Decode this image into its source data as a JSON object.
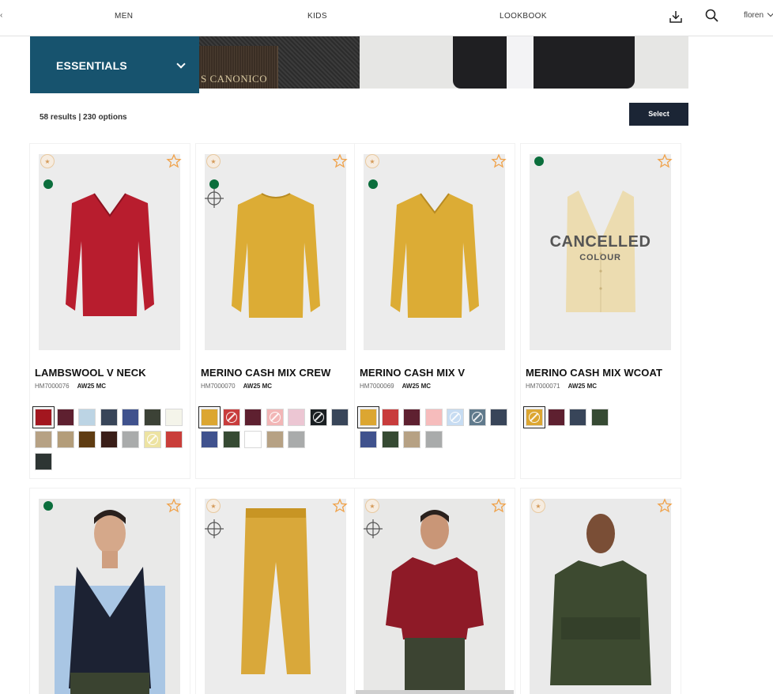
{
  "nav": {
    "edge": "‹",
    "links": [
      "MEN",
      "KIDS",
      "LOOKBOOK"
    ],
    "user": "floren"
  },
  "banner": {
    "category": "ESSENTIALS",
    "fabric_text": "S CANONICO"
  },
  "results": {
    "summary": "58 results | 230 options",
    "select_label": "Select"
  },
  "colors": {
    "accent": "#17536e",
    "button": "#1b2535",
    "available": "#0b6e3c",
    "favorite": "#f0a24a"
  },
  "products": [
    {
      "name": "LAMBSWOOL V NECK",
      "code": "HM7000076",
      "season": "AW25 MC",
      "garment_color": "#b81d2e",
      "swatches": [
        "#a3161f",
        "#5e2030",
        "#bcd4e4",
        "#384559",
        "#40528d",
        "#3c4236",
        "#f4f4ea",
        "#b6a184",
        "#b39d7a",
        "#5f3c12",
        "#3a1e18",
        "#a9abab",
        "#ede3a2",
        "#c93e3a",
        "#2d3533"
      ],
      "banned": [
        12
      ]
    },
    {
      "name": "MERINO CASH MIX CREW",
      "code": "HM7000070",
      "season": "AW25 MC",
      "garment_color": "#dcac35",
      "swatches": [
        "#dca631",
        "#c83c3c",
        "#5e2030",
        "#f2b6b6",
        "#ecc6d3",
        "#1a1f22",
        "#384559",
        "#40528d",
        "#364a33",
        "#ffffff",
        "#b6a184",
        "#a9abab"
      ],
      "banned": [
        1,
        3,
        5
      ]
    },
    {
      "name": "MERINO CASH MIX V",
      "code": "HM7000069",
      "season": "AW25 MC",
      "garment_color": "#dcac35",
      "swatches": [
        "#dca631",
        "#c83c3c",
        "#5e2030",
        "#f6bcbc",
        "#c7dcf2",
        "#607a8c",
        "#384559",
        "#40528d",
        "#364a33",
        "#b6a184",
        "#a9abab"
      ],
      "banned": [
        4,
        5
      ]
    },
    {
      "name": "MERINO CASH MIX WCOAT",
      "code": "HM7000071",
      "season": "AW25 MC",
      "garment_color": "#ecdcb0",
      "cancelled": "CANCELLED",
      "cancelled_sub": "COLOUR",
      "swatches": [
        "#dca631",
        "#5e2030",
        "#384559",
        "#364a33"
      ],
      "banned": [
        0
      ]
    }
  ]
}
